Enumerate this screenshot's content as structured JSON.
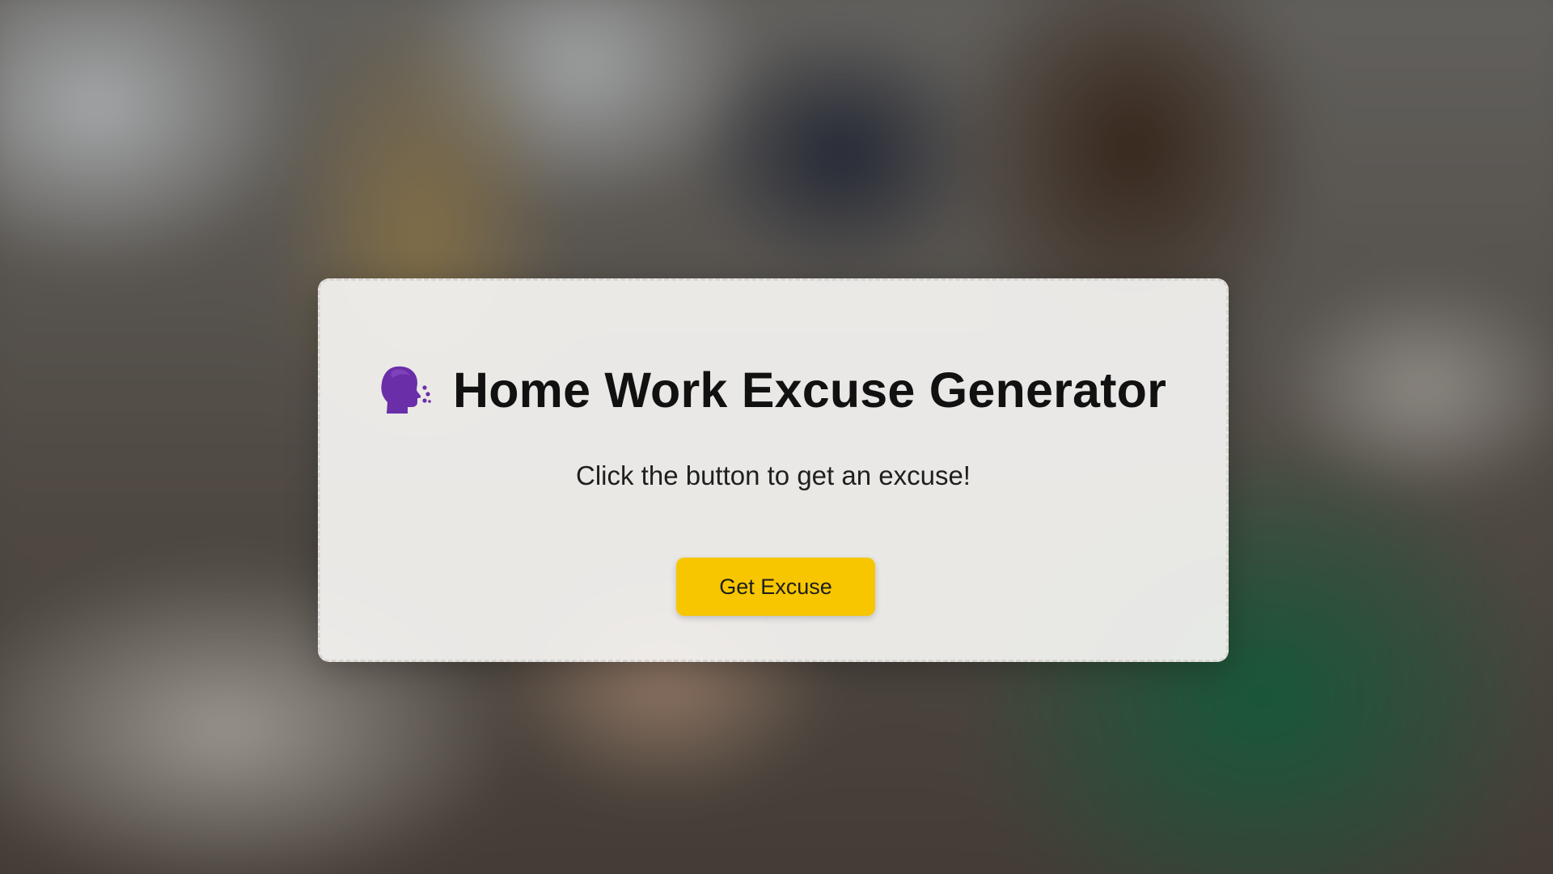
{
  "app": {
    "title": "Home Work Excuse Generator",
    "icon": "speaking-head-icon",
    "subtitle": "Click the button to get an excuse!",
    "button_label": "Get Excuse"
  },
  "colors": {
    "button_bg": "#f7c600",
    "icon": "#6a2fa8",
    "card_bg": "#f5f4f2"
  }
}
